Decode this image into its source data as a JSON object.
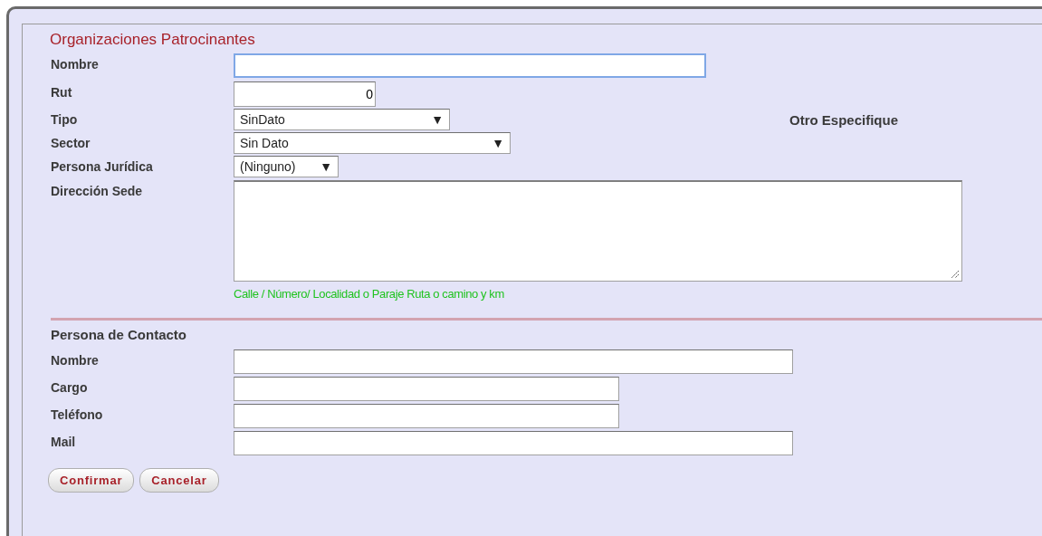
{
  "title": "Organizaciones Patrocinantes",
  "fields": [
    {
      "kind": "text",
      "label": "Nombre",
      "focused": true
    },
    {
      "kind": "number",
      "label": "Rut",
      "value": "0"
    },
    {
      "kind": "select",
      "label": "Tipo",
      "value": "SinDato",
      "arrow": "▼",
      "side_label": "Otro Especifique"
    },
    {
      "kind": "select",
      "label": "Sector",
      "value": "Sin Dato",
      "arrow": "▼"
    },
    {
      "kind": "select",
      "label": "Persona Jurídica",
      "value": "(Ninguno)",
      "arrow": "▼"
    },
    {
      "kind": "textarea",
      "label": "Dirección Sede",
      "hint": "Calle / Número/ Localidad o Paraje Ruta o camino y km"
    }
  ],
  "contact": {
    "heading": "Persona de Contacto",
    "fields": [
      {
        "label": "Nombre"
      },
      {
        "label": "Cargo"
      },
      {
        "label": "Teléfono"
      },
      {
        "label": "Mail"
      }
    ]
  },
  "buttons": [
    "Confirmar",
    "Cancelar"
  ]
}
